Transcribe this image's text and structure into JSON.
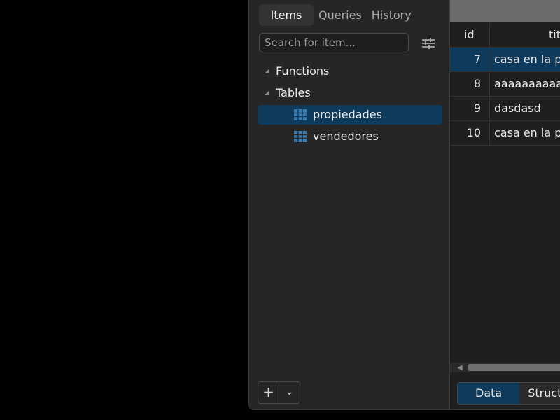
{
  "sidebar": {
    "tabs": [
      {
        "label": "Items",
        "active": true
      },
      {
        "label": "Queries",
        "active": false
      },
      {
        "label": "History",
        "active": false
      }
    ],
    "search_placeholder": "Search for item...",
    "tree": {
      "groups": [
        {
          "label": "Functions",
          "expanded": false
        },
        {
          "label": "Tables",
          "expanded": true
        }
      ],
      "tables": [
        {
          "label": "propiedades",
          "selected": true
        },
        {
          "label": "vendedores",
          "selected": false
        }
      ]
    },
    "bottom": {
      "add_label": "+",
      "menu_label": "⌄"
    }
  },
  "grid": {
    "columns": [
      "id",
      "titulo"
    ],
    "rows": [
      {
        "id": "7",
        "titulo": "casa en la playa",
        "selected": true
      },
      {
        "id": "8",
        "titulo": "aaaaaaaaaaaa",
        "selected": false
      },
      {
        "id": "9",
        "titulo": "dasdasd",
        "selected": false
      },
      {
        "id": "10",
        "titulo": "casa en la playa",
        "selected": false
      }
    ]
  },
  "bottom_tabs": [
    {
      "label": "Data",
      "active": true
    },
    {
      "label": "Structure",
      "active": false
    }
  ],
  "colors": {
    "selection": "#0e3a5b",
    "panel": "#262626",
    "background": "#000000"
  }
}
